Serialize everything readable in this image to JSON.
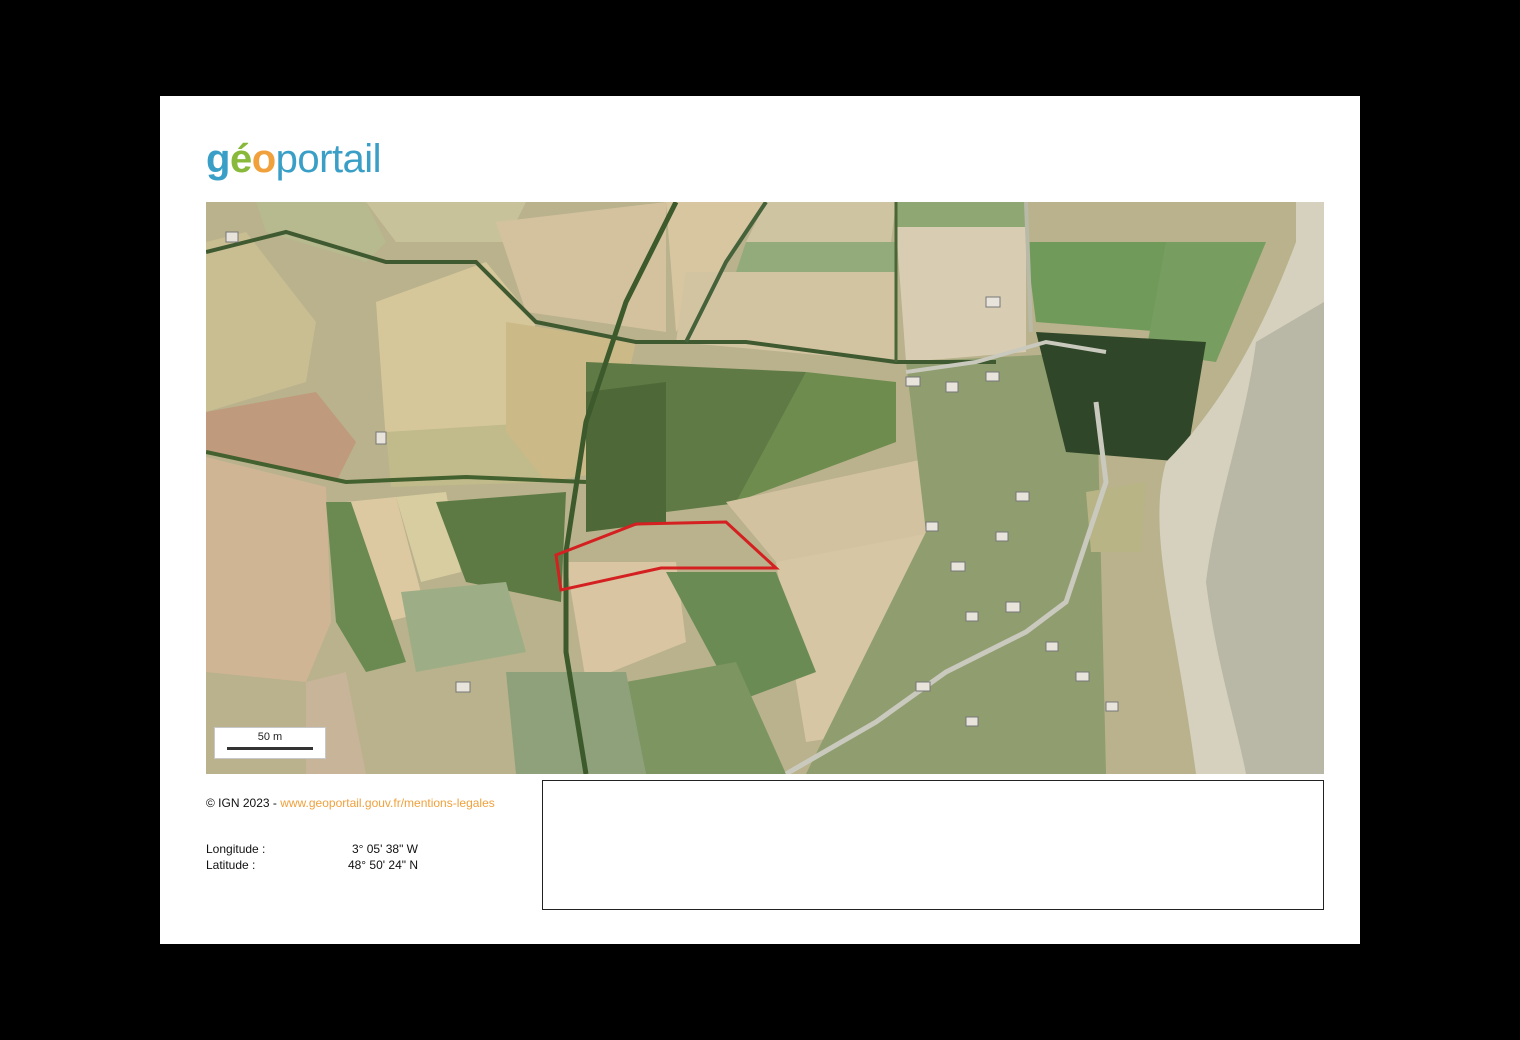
{
  "logo": {
    "part_g": "g",
    "part_e": "é",
    "part_o": "o",
    "part_rest": "portail",
    "colors": {
      "blue": "#3a9fc6",
      "green": "#89b93b",
      "orange": "#f0a13c"
    }
  },
  "map": {
    "imagery": "aerial-photo",
    "parcel_outline_color": "#d42020",
    "scale_label": "50 m"
  },
  "footer": {
    "copyright": "© IGN 2023 - ",
    "legal_link": "www.geoportail.gouv.fr/mentions-legales"
  },
  "coordinates": {
    "longitude_label": "Longitude :",
    "longitude_value": "3° 05' 38\" W",
    "latitude_label": "Latitude :",
    "latitude_value": "48° 50' 24\" N"
  },
  "notes_box": {
    "text": ""
  }
}
